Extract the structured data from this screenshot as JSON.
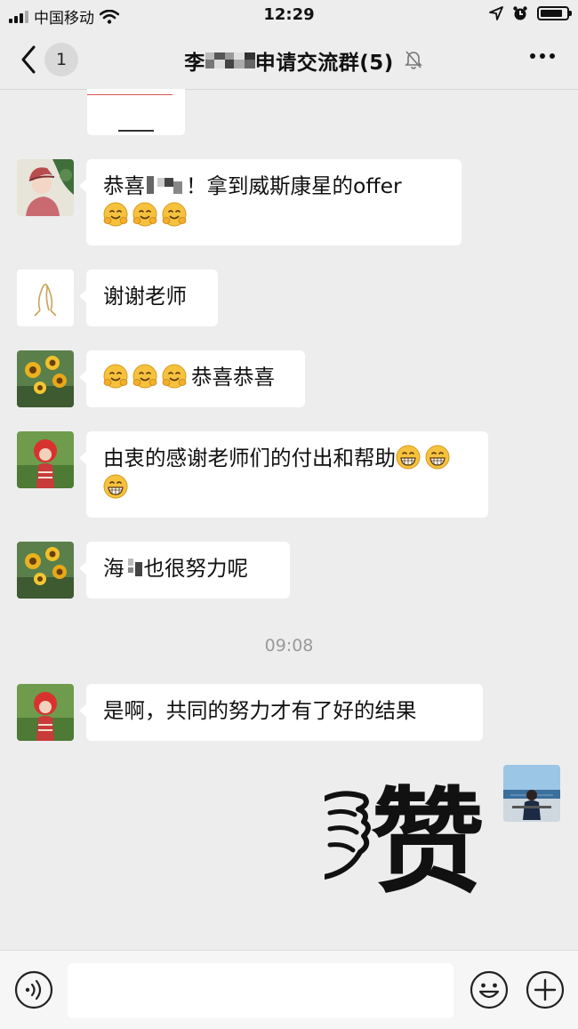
{
  "status_bar": {
    "carrier": "中国移动",
    "time": "12:29",
    "battery_level": 0.85
  },
  "nav": {
    "unread_count": "1",
    "title": "李     申请交流群(5)",
    "title_prefix": "李",
    "title_suffix": "申请交流群(5)"
  },
  "messages": [
    {
      "text_before": "恭喜",
      "text_mid": "！拿到威斯康星的offer",
      "emoji": [
        "hug-face",
        "hug-face",
        "hug-face"
      ]
    },
    {
      "text": "谢谢老师"
    },
    {
      "emoji": [
        "hug-face",
        "hug-face",
        "hug-face"
      ],
      "text": "恭喜恭喜"
    },
    {
      "text": "由衷的感谢老师们的付出和帮助",
      "emoji": [
        "grin-face",
        "grin-face",
        "grin-face"
      ]
    },
    {
      "text_before": "海",
      "text_after": "也很努力呢"
    },
    {
      "text": "是啊，共同的努力才有了好的结果"
    }
  ],
  "time_separator": "09:08",
  "sticker": {
    "text": "赞"
  },
  "colors": {
    "background": "#ededed",
    "bubble": "#ffffff",
    "timestamp": "#9a9a9a"
  },
  "icons": [
    "voice-icon",
    "emoji-icon",
    "plus-icon",
    "back-chevron-icon",
    "mute-bell-icon",
    "more-icon"
  ]
}
